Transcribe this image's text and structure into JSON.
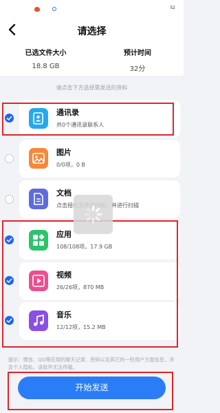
{
  "status_bar": {
    "battery": "52"
  },
  "header": {
    "title": "请选择",
    "back_icon": "chevron-left-icon"
  },
  "summary": {
    "selected_size_label": "已选文件大小",
    "selected_size_value": "18.8 GB",
    "estimated_time_label": "预计时间",
    "estimated_time_value": "32分"
  },
  "hint": "请点击下方选择需发送的资料",
  "items": [
    {
      "name": "通讯录",
      "desc": "共0个通讯录联系人",
      "checked": true,
      "icon": "contacts-icon",
      "color": "#28a8ec"
    },
    {
      "name": "图片",
      "desc": "0/0项，0 B",
      "checked": false,
      "icon": "image-icon",
      "color": "#f5883a"
    },
    {
      "name": "文档",
      "desc": "点击授权文件访问权，并进行扫描",
      "checked": false,
      "icon": "document-icon",
      "color": "#5f6bdc"
    },
    {
      "name": "应用",
      "desc": "108/108项，17.9 GB",
      "checked": true,
      "icon": "apps-icon",
      "color": "#2bc46a"
    },
    {
      "name": "视频",
      "desc": "26/26项，870 MB",
      "checked": true,
      "icon": "video-icon",
      "color": "#ec4f8d"
    },
    {
      "name": "音乐",
      "desc": "12/12项，15.2 MB",
      "checked": true,
      "icon": "music-icon",
      "color": "#8a4fe3"
    }
  ],
  "tip": "提示：微信、QQ等应用的聊天记录、密码以及其它的一些用户方面信息，涉及个人隐私，该软件无法传输。",
  "start_button": "开始发送",
  "colors": {
    "accent": "#2a7df7",
    "highlight": "#e0242a"
  }
}
